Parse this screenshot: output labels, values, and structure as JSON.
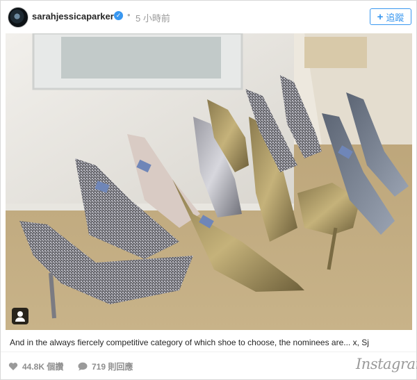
{
  "post": {
    "username": "sarahjessicaparker",
    "separator": "•",
    "time_ago": "5 小時前",
    "follow_label": "追蹤",
    "caption": "And in the always fiercely competitive category of which shoe to choose, the nominees are... x, Sj",
    "likes": "44.8K 個讚",
    "comments": "719 則回應",
    "logo_text": "Instagram",
    "verified_mark": "✓"
  },
  "icons": {
    "avatar": "avatar-photo",
    "verified": "verified-badge-icon",
    "follow": "plus-icon",
    "photo_tag": "person-tag-icon",
    "likes": "heart-icon",
    "comments": "speech-bubble-icon"
  },
  "colors": {
    "accent": "#3897f0",
    "muted_text": "#8e8e8e",
    "text": "#262626"
  }
}
